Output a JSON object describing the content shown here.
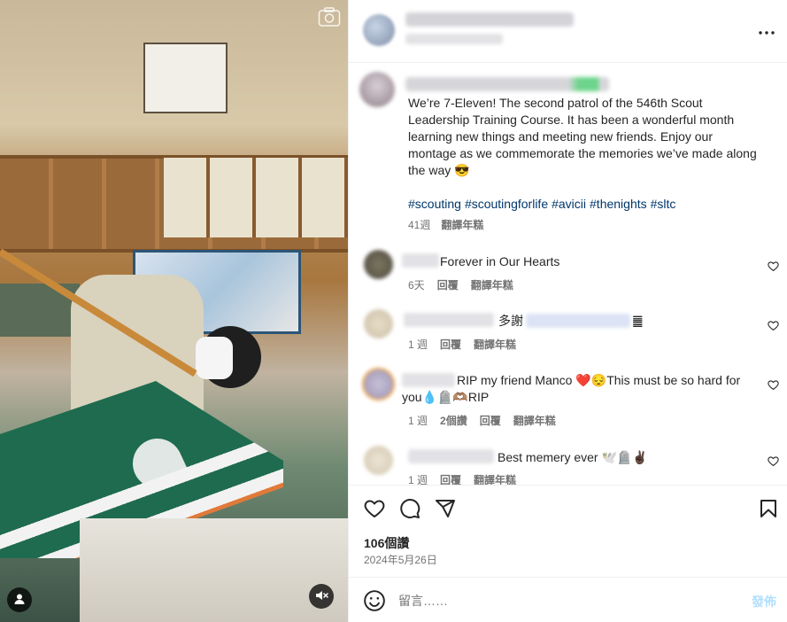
{
  "post": {
    "caption": "We’re 7-Eleven! The second patrol of the 546th Scout Leadership Training Course. It has been a wonderful month learning new things and meeting new friends. Enjoy our montage as we commemorate the memories we’ve made along the way 😎",
    "hashtags": [
      "#scouting",
      "#scoutingforlife",
      "#avicii",
      "#thenights",
      "#sltc"
    ],
    "time": "41週",
    "translate_label": "翻譯年糕",
    "likes": "106個讚",
    "date": "2024年5月26日"
  },
  "comments": [
    {
      "text": "Forever in Our Hearts",
      "time": "6天",
      "reply_label": "回覆",
      "translate_label": "翻譯年糕"
    },
    {
      "text": "多謝",
      "suffix": "䷀",
      "time": "1 週",
      "reply_label": "回覆",
      "translate_label": "翻譯年糕"
    },
    {
      "text": "RIP my friend Manco ❤️😔This must be so hard for you💧🪦🫶🏽RIP",
      "time": "1 週",
      "likes_count": "2個讚",
      "reply_label": "回覆",
      "translate_label": "翻譯年糕"
    },
    {
      "text": "Best memery ever 🕊️🪦✌🏿",
      "time": "1 週",
      "reply_label": "回覆",
      "translate_label": "翻譯年糕"
    }
  ],
  "compose": {
    "placeholder": "留言……",
    "post_label": "發佈"
  },
  "icons": {
    "more": "more-options-icon",
    "like": "heart-icon",
    "comment": "comment-icon",
    "share": "share-icon",
    "save": "bookmark-icon",
    "emoji": "emoji-icon",
    "mute": "muted-speaker-icon",
    "user": "user-tag-icon",
    "camera": "camera-icon"
  },
  "colors": {
    "hashtag": "#00376b",
    "meta": "#737373",
    "post_button_disabled": "#b2dffc"
  }
}
